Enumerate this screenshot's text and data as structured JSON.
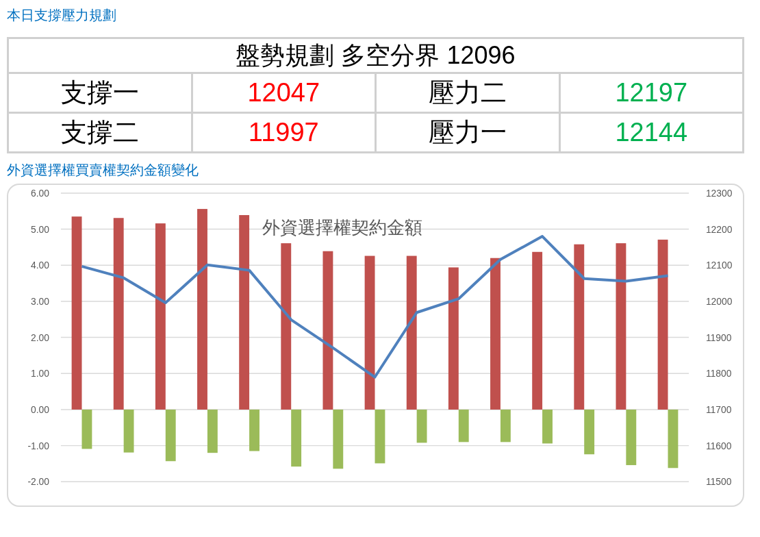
{
  "plan_title": "本日支撐壓力規劃",
  "plan_table": {
    "header": "盤勢規劃 多空分界 12096",
    "rows": [
      {
        "cells": [
          {
            "text": "支撐一"
          },
          {
            "text": "12047",
            "color": "#ff0000"
          },
          {
            "text": "壓力二"
          },
          {
            "text": "12197",
            "color": "#00b050"
          }
        ]
      },
      {
        "cells": [
          {
            "text": "支撐二"
          },
          {
            "text": "11997",
            "color": "#ff0000"
          },
          {
            "text": "壓力一"
          },
          {
            "text": "12144",
            "color": "#00b050"
          }
        ]
      }
    ]
  },
  "chart_heading": "外資選擇權買賣權契約金額變化",
  "chart": {
    "chart_data": {
      "type": "bar",
      "grid": true,
      "title": "外資選擇權契約金額",
      "ylim": [
        -2,
        6
      ],
      "yticks": [
        {
          "value": 6,
          "label": "6.00"
        },
        {
          "value": 5,
          "label": "5.00"
        },
        {
          "value": 4,
          "label": "4.00"
        },
        {
          "value": 3,
          "label": "3.00"
        },
        {
          "value": 2,
          "label": "2.00"
        },
        {
          "value": 1,
          "label": "1.00"
        },
        {
          "value": 0,
          "label": "0.00"
        },
        {
          "value": -1,
          "label": "-1.00"
        },
        {
          "value": -2,
          "label": "-2.00"
        }
      ],
      "y2lim": [
        11500,
        12300
      ],
      "y2ticks": [
        12300,
        12200,
        12100,
        12000,
        11900,
        11800,
        11700,
        11600,
        11500
      ],
      "series": [
        {
          "color": "#c0504d",
          "values": [
            5.35,
            5.31,
            5.16,
            5.56,
            5.39,
            4.61,
            4.39,
            4.26,
            4.26,
            3.94,
            4.2,
            4.37,
            4.58,
            4.61,
            4.71
          ]
        },
        {
          "color": "#9bbb59",
          "values": [
            -1.09,
            -1.19,
            -1.43,
            -1.2,
            -1.15,
            -1.58,
            -1.64,
            -1.49,
            -0.92,
            -0.9,
            -0.9,
            -0.94,
            -1.24,
            -1.54,
            -1.62
          ]
        },
        {
          "type": "line",
          "axis": "y2",
          "color": "#4f81bd",
          "values": [
            12097,
            12065,
            11996,
            12101,
            12086,
            11949,
            11871,
            11790,
            11969,
            12007,
            12116,
            12180,
            12063,
            12056,
            12071
          ]
        }
      ]
    }
  }
}
